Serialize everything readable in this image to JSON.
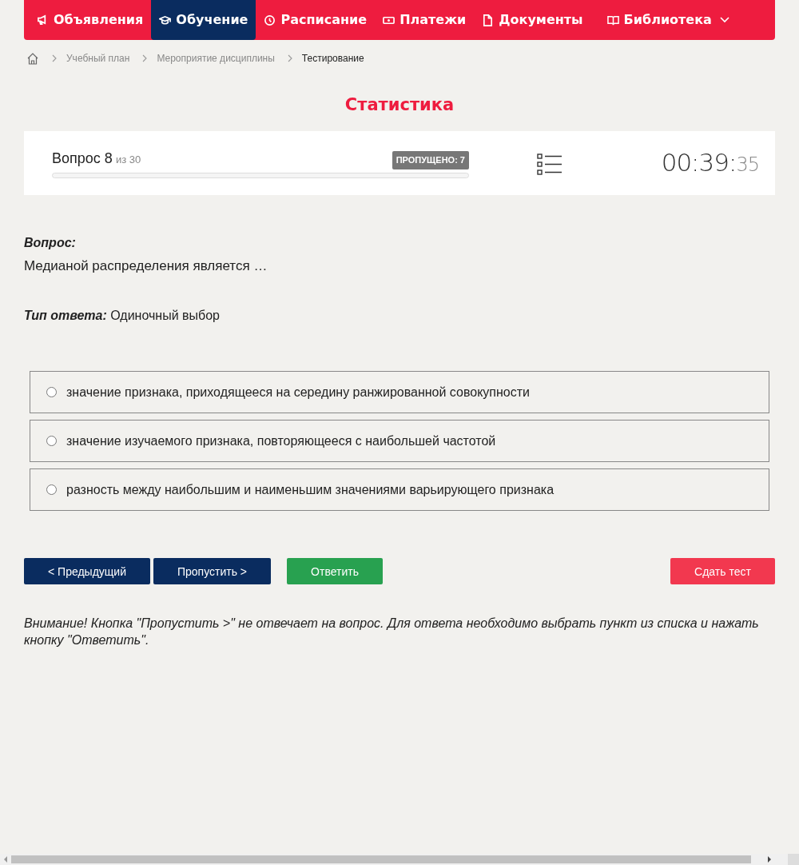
{
  "nav": [
    {
      "label": "Объявления",
      "selected": false
    },
    {
      "label": "Обучение",
      "selected": true
    },
    {
      "label": "Расписание",
      "selected": false
    },
    {
      "label": "Платежи",
      "selected": false
    },
    {
      "label": "Документы",
      "selected": false
    },
    {
      "label": "Библиотека",
      "selected": false,
      "dropdown": true
    }
  ],
  "breadcrumb": [
    "Учебный план",
    "Мероприятие дисциплины",
    "Тестирование"
  ],
  "title": "Статистика",
  "progress": {
    "question": "Вопрос 8",
    "of": "из 30",
    "skipped": "ПРОПУЩЕНО: 7",
    "timer_main": "00:39:",
    "timer_seconds": "35"
  },
  "question": {
    "label": "Вопрос:",
    "text": "Медианой распределения является …",
    "type_label": "Тип ответа:",
    "type_value": "Одиночный выбор"
  },
  "options": [
    {
      "text": "значение признака, приходящееся на середину ранжированной совокупности",
      "selected": false
    },
    {
      "text": "значение изучаемого признака, повторяющееся с наибольшей частотой",
      "selected": false
    },
    {
      "text": "разность между наибольшим и наименьшим значениями варьирующего признака",
      "selected": false
    }
  ],
  "buttons": [
    {
      "label": "< Предыдущий",
      "kind": "nav"
    },
    {
      "label": "Пропустить >",
      "kind": "nav"
    },
    {
      "label": "Ответить",
      "kind": "answer"
    },
    {
      "label": "Сдать тест",
      "kind": "submit"
    }
  ],
  "notice": "Внимание! Кнопка \"Пропустить >\" не отвечает на вопрос. Для ответа необходимо выбрать пункт из списка и нажать кнопку \"Ответить\"."
}
